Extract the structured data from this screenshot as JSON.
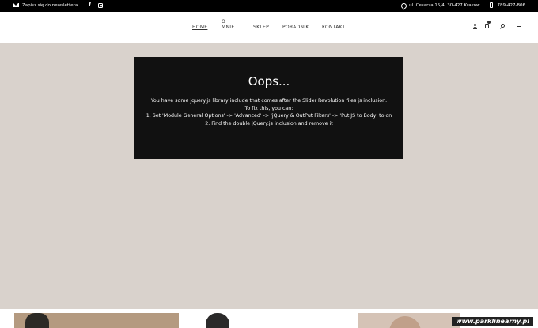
{
  "topbar": {
    "newsletter": "Zapisz się do newslettera",
    "facebook": "f",
    "address": "ul. Cesarza 15/4, 30-427 Kraków",
    "phone": "789-427-806"
  },
  "nav": {
    "home": "HOME",
    "omnie": "O MNIE",
    "sklep": "SKLEP",
    "poradnik": "PORADNIK",
    "kontakt": "KONTAKT"
  },
  "error": {
    "title": "Oops...",
    "line1": "You have some jquery.js library include that comes after the Slider Revolution files js inclusion.",
    "line2": "To fix this, you can:",
    "line3": "1. Set 'Module General Options' -> 'Advanced' -> 'jQuery & OutPut Filters' -> 'Put JS to Body' to on",
    "line4": "2. Find the double jQuery.js inclusion and remove it"
  },
  "watermark": "www.parklinearny.pl",
  "icons": [
    "mail-icon",
    "facebook-icon",
    "instagram-icon",
    "location-pin-icon",
    "phone-icon",
    "user-icon",
    "shopping-bag-icon",
    "search-icon",
    "menu-icon"
  ]
}
